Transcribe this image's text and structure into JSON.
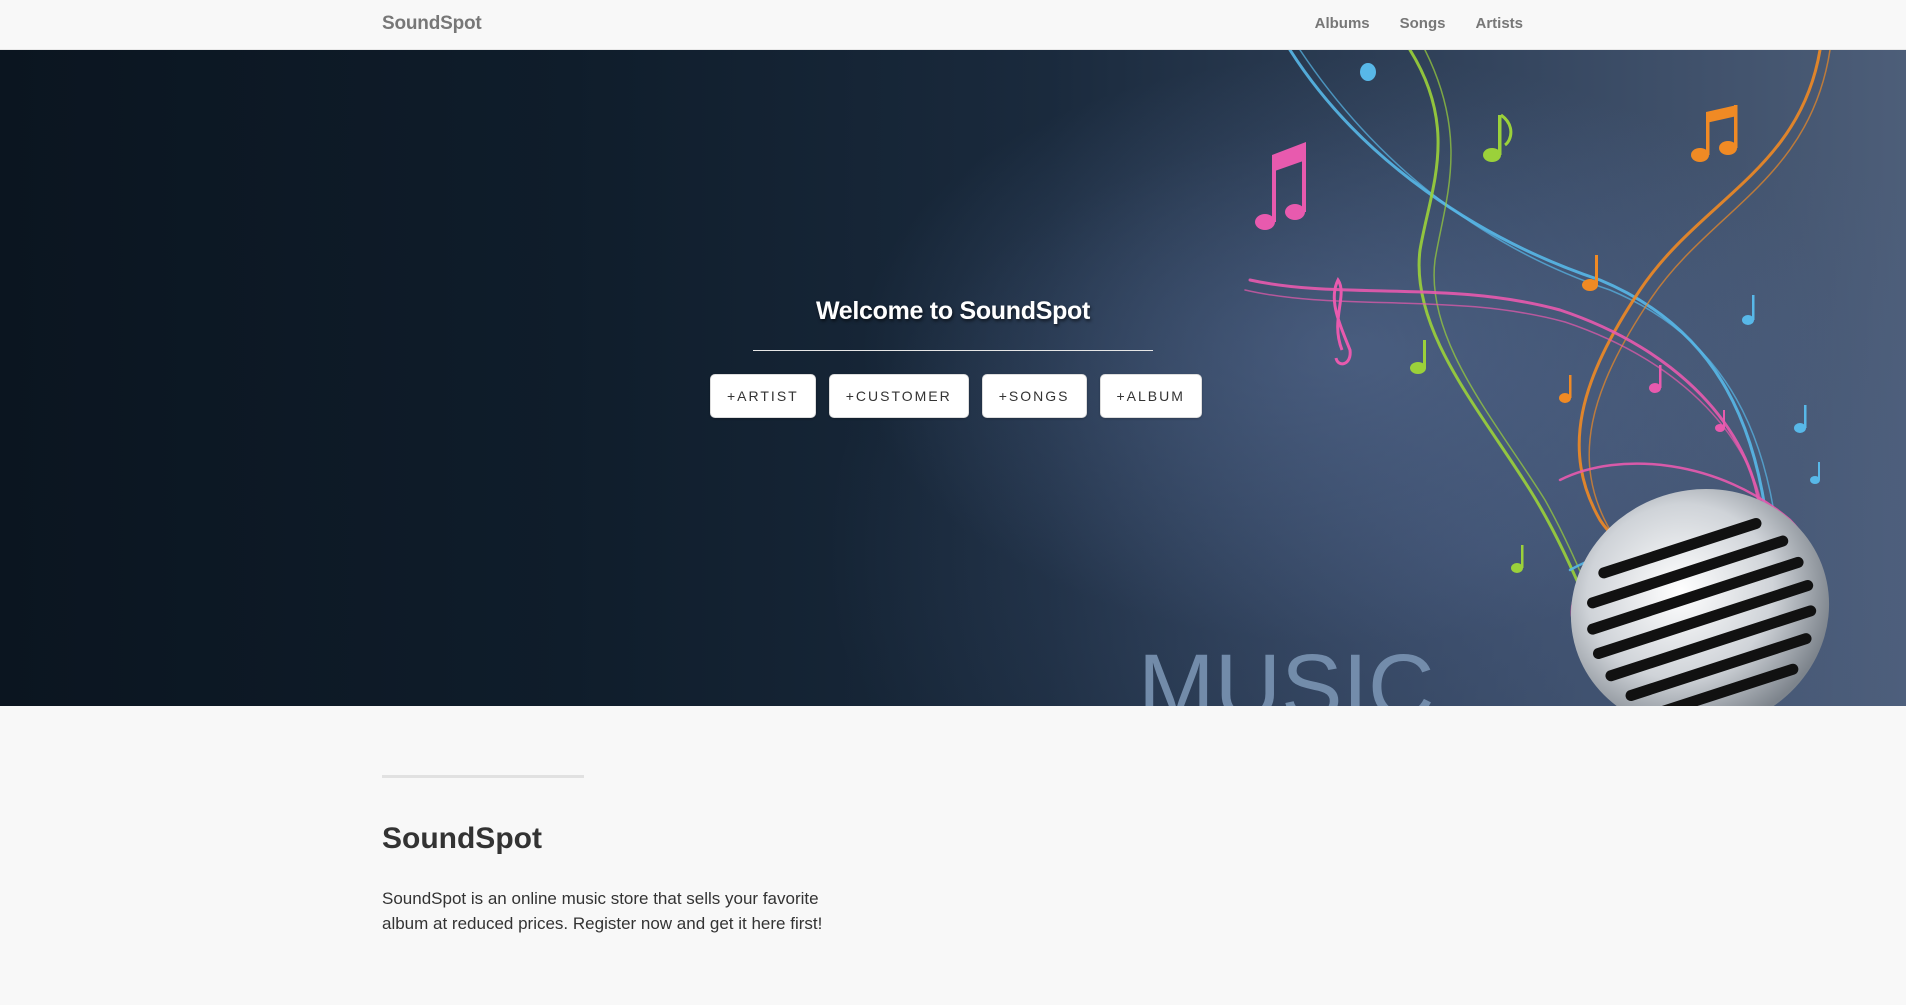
{
  "navbar": {
    "brand": "SoundSpot",
    "links": [
      "Albums",
      "Songs",
      "Artists"
    ]
  },
  "hero": {
    "title": "Welcome to SoundSpot",
    "buttons": [
      "+ARTIST",
      "+CUSTOMER",
      "+SONGS",
      "+ALBUM"
    ],
    "art_text": "MUSIC"
  },
  "content": {
    "title": "SoundSpot",
    "description": "SoundSpot is an online music store that sells your favorite album at reduced prices. Register now and get it here first!"
  },
  "colors": {
    "navbar_bg": "#f8f8f8",
    "hero_dark": "#0b1520",
    "hero_light": "#4d5e79",
    "note_pink": "#e85aae",
    "note_orange": "#f08a24",
    "note_green": "#9bd13a",
    "note_blue": "#58b8e8"
  },
  "icons": {
    "hero_decoration": "microphone-icon",
    "notes": "music-note-icon"
  }
}
